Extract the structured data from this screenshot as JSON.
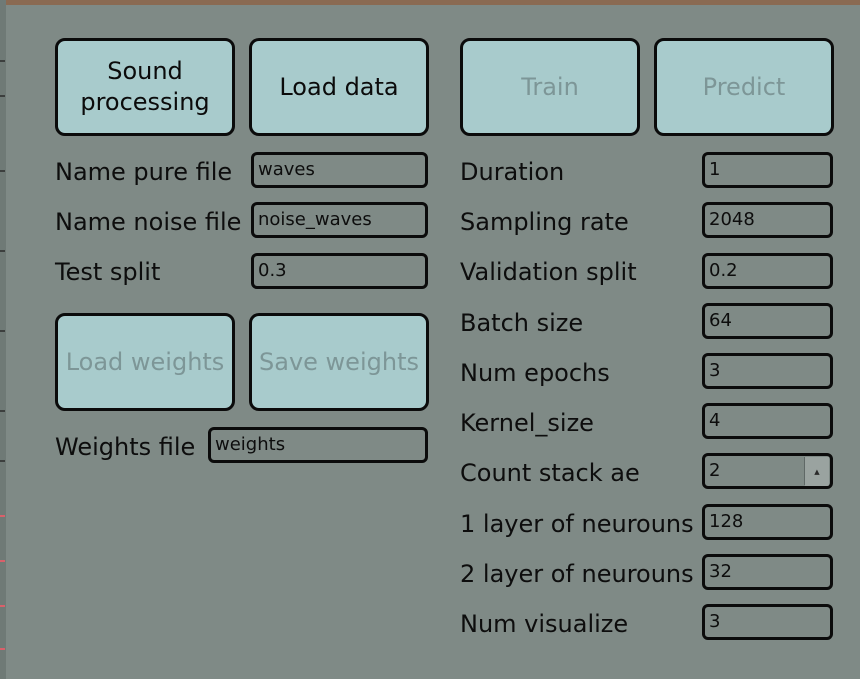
{
  "left": {
    "sound_processing": "Sound\nprocessing",
    "load_data": "Load data",
    "name_pure_file": {
      "label": "Name pure file",
      "value": "waves"
    },
    "name_noise_file": {
      "label": "Name noise file",
      "value": "noise_waves"
    },
    "test_split": {
      "label": "Test split",
      "value": "0.3"
    },
    "load_weights": "Load weights",
    "save_weights": "Save weights",
    "weights_file": {
      "label": "Weights file",
      "value": "weights"
    }
  },
  "right": {
    "train": "Train",
    "predict": "Predict",
    "duration": {
      "label": "Duration",
      "value": "1"
    },
    "sampling_rate": {
      "label": "Sampling rate",
      "value": "2048"
    },
    "validation_split": {
      "label": "Validation split",
      "value": "0.2"
    },
    "batch_size": {
      "label": "Batch size",
      "value": "64"
    },
    "num_epochs": {
      "label": "Num epochs",
      "value": "3"
    },
    "kernel_size": {
      "label": "Kernel_size",
      "value": "4"
    },
    "count_stack_ae": {
      "label": "Count stack ae",
      "value": "2"
    },
    "layer1_neurons": {
      "label": "1 layer of neurouns",
      "value": "128"
    },
    "layer2_neurons": {
      "label": "2 layer of neurouns",
      "value": "32"
    },
    "num_visualize": {
      "label": "Num visualize",
      "value": "3"
    }
  },
  "icons": {
    "spin_up": "▲",
    "spin_down": "▼"
  },
  "colors": {
    "background": "#7f8a86",
    "button_fill": "#a8cbcc",
    "button_disabled_text": "#7d9697",
    "border": "#0b0b0b"
  }
}
